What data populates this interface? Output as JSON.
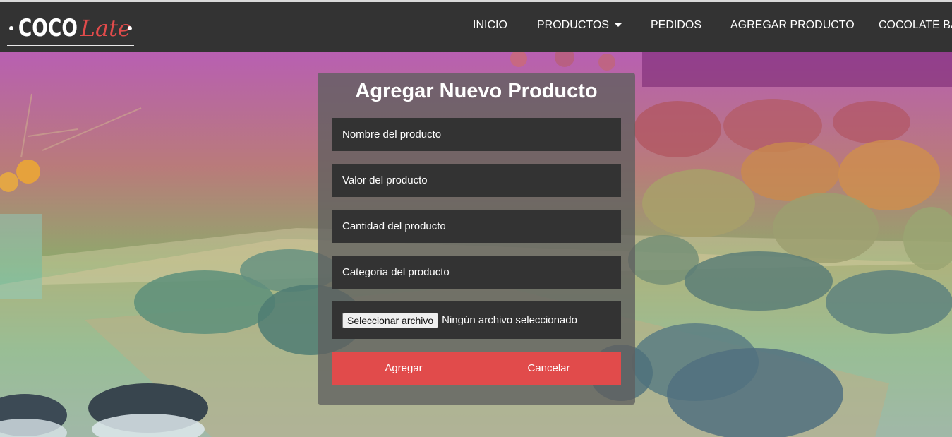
{
  "brand": {
    "logo_part1": "COCO",
    "logo_part2": "Late",
    "accent_color": "#e14b4b"
  },
  "nav": {
    "items": [
      {
        "label": "INICIO"
      },
      {
        "label": "PRODUCTOS",
        "has_dropdown": true
      },
      {
        "label": "PEDIDOS"
      },
      {
        "label": "AGREGAR PRODUCTO"
      },
      {
        "label": "COCOLATE BA"
      }
    ]
  },
  "form": {
    "title": "Agregar Nuevo Producto",
    "fields": [
      {
        "placeholder": "Nombre del producto"
      },
      {
        "placeholder": "Valor del producto"
      },
      {
        "placeholder": "Cantidad del producto"
      },
      {
        "placeholder": "Categoria del producto"
      }
    ],
    "file": {
      "button_label": "Seleccionar archivo",
      "status": "Ningún archivo seleccionado"
    },
    "submit_label": "Agregar",
    "cancel_label": "Cancelar"
  }
}
